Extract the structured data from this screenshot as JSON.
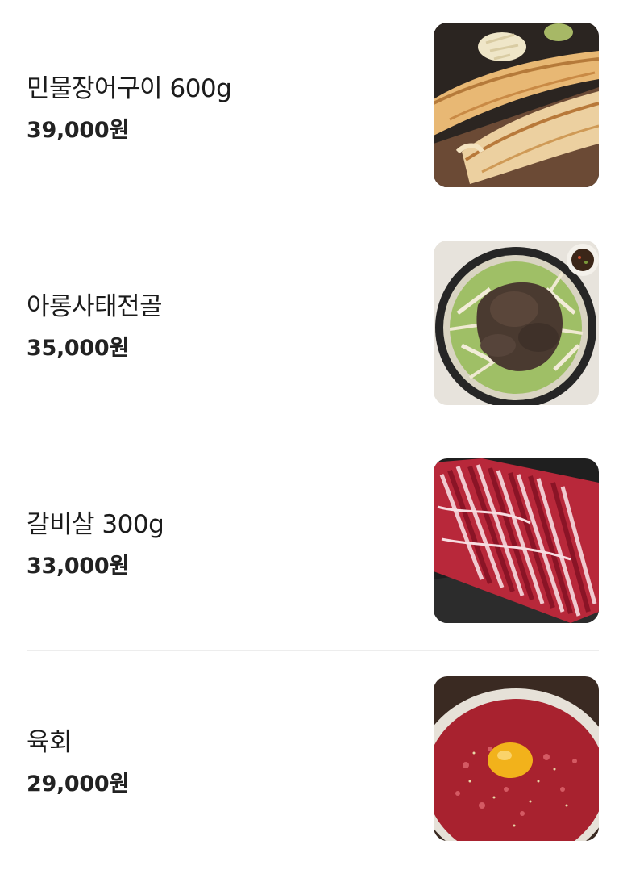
{
  "menu": {
    "items": [
      {
        "name": "민물장어구이 600g",
        "price": "39,000원",
        "image": "grilled-eel-photo"
      },
      {
        "name": "아롱사태전골",
        "price": "35,000원",
        "image": "beef-shank-hotpot-photo"
      },
      {
        "name": "갈비살 300g",
        "price": "33,000원",
        "image": "raw-short-rib-photo"
      },
      {
        "name": "육회",
        "price": "29,000원",
        "image": "beef-tartare-photo"
      }
    ]
  }
}
